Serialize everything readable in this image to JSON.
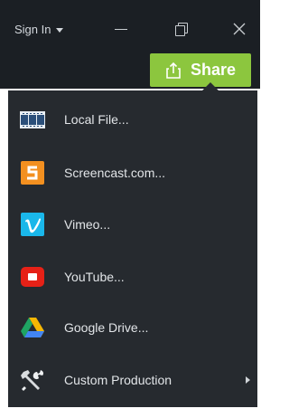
{
  "window": {
    "sign_in_label": "Sign In",
    "controls": [
      "minimize-icon",
      "restore-icon",
      "close-icon"
    ]
  },
  "share": {
    "label": "Share",
    "icon": "share-upload-icon",
    "color": "#8cc63e"
  },
  "menu": {
    "items": [
      {
        "label": "Local File...",
        "icon": "local-file-film-icon"
      },
      {
        "label": "Screencast.com...",
        "icon": "screencast-s-icon"
      },
      {
        "label": "Vimeo...",
        "icon": "vimeo-v-icon"
      },
      {
        "label": "YouTube...",
        "icon": "youtube-play-icon"
      },
      {
        "label": "Google Drive...",
        "icon": "google-drive-icon"
      },
      {
        "label": "Custom Production",
        "icon": "tools-icon",
        "has_submenu": true
      }
    ]
  },
  "colors": {
    "background_dark": "#1b1f24",
    "menu_background": "#262a2f",
    "text": "#e2e5e8",
    "screencast_orange": "#f39020",
    "vimeo_blue": "#1ab7ea",
    "youtube_red": "#e62117"
  }
}
